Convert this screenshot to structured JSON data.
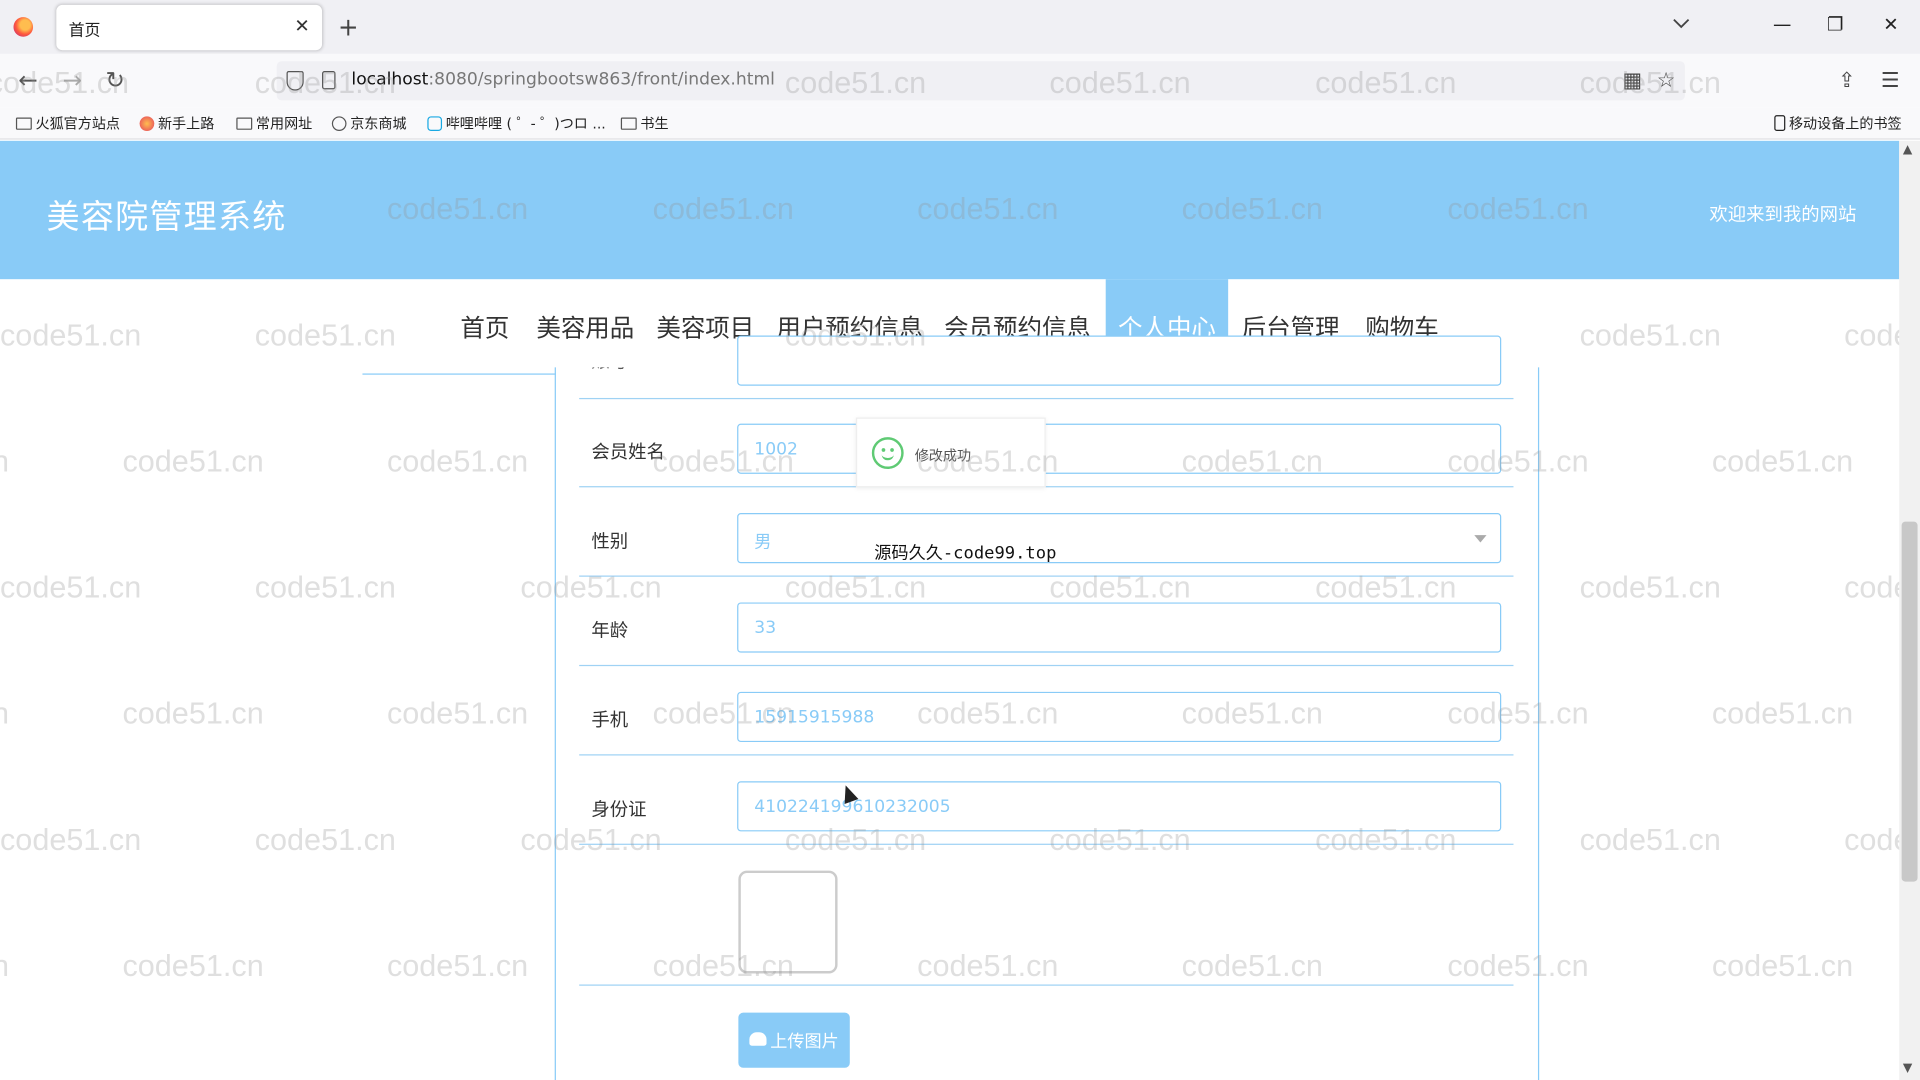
{
  "browser": {
    "tab_title": "首页",
    "tab_close": "✕",
    "new_tab": "+",
    "url_host": "localhost",
    "url_path": ":8080/springbootsw863/front/index.html",
    "window_controls": {
      "minimize": "—",
      "maximize": "❐",
      "close": "✕"
    },
    "nav": {
      "back": "←",
      "forward": "→",
      "reload": "↻"
    },
    "bookmarks": [
      {
        "label": "火狐官方站点",
        "icon": "folder-icon"
      },
      {
        "label": "新手上路",
        "icon": "firefox-icon"
      },
      {
        "label": "常用网址",
        "icon": "folder-icon"
      },
      {
        "label": "京东商城",
        "icon": "globe-icon"
      },
      {
        "label": "哔哩哔哩 ( ゜- ゜)つロ ...",
        "icon": "bilibili-icon"
      },
      {
        "label": "书生",
        "icon": "folder-icon"
      }
    ],
    "mobile_bookmarks": "移动设备上的书签"
  },
  "site": {
    "title": "美容院管理系统",
    "welcome": "欢迎来到我的网站"
  },
  "menu": [
    {
      "label": "首页"
    },
    {
      "label": "美容用品"
    },
    {
      "label": "美容项目"
    },
    {
      "label": "用户预约信息"
    },
    {
      "label": "会员预约信息"
    },
    {
      "label": "个人中心",
      "active": true
    },
    {
      "label": "后台管理"
    },
    {
      "label": "购物车"
    }
  ],
  "form": {
    "partial_label": "账号",
    "fields": [
      {
        "label": "会员姓名",
        "value": "1002"
      },
      {
        "label": "性别",
        "value": "男"
      },
      {
        "label": "年龄",
        "value": "33"
      },
      {
        "label": "手机",
        "value": "15915915988"
      },
      {
        "label": "身份证",
        "value": "410224199610232005"
      }
    ],
    "upload_label": "上传图片"
  },
  "toast": {
    "message": "修改成功"
  },
  "overlay_text": "源码久久-code99.top",
  "watermark": "code51.cn",
  "colors": {
    "accent": "#89cbf7",
    "toast_icon": "#5fca74"
  }
}
